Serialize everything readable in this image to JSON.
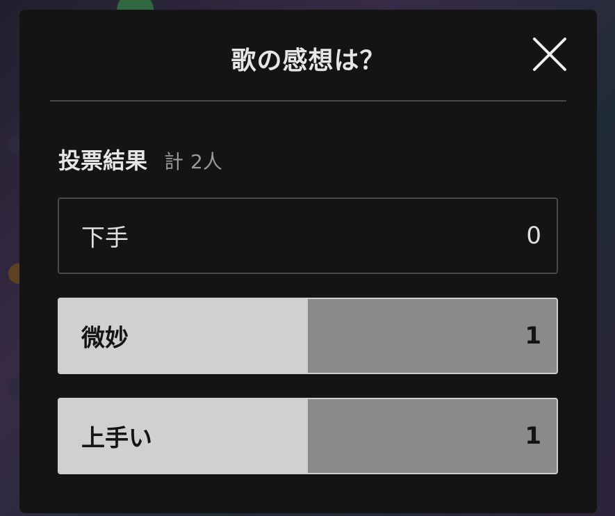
{
  "dialog": {
    "title": "歌の感想は？",
    "close_icon": "close-icon"
  },
  "results": {
    "label": "投票結果",
    "total_prefix": "計",
    "total_value": "2人"
  },
  "options": [
    {
      "label": "下手",
      "count": "0",
      "fraction": 0.0
    },
    {
      "label": "微妙",
      "count": "1",
      "fraction": 0.5
    },
    {
      "label": "上手い",
      "count": "1",
      "fraction": 0.5
    }
  ],
  "colors": {
    "modal_bg": "#141414",
    "bar_light": "#d0d0d0",
    "bar_fill": "#8a8a8a"
  }
}
